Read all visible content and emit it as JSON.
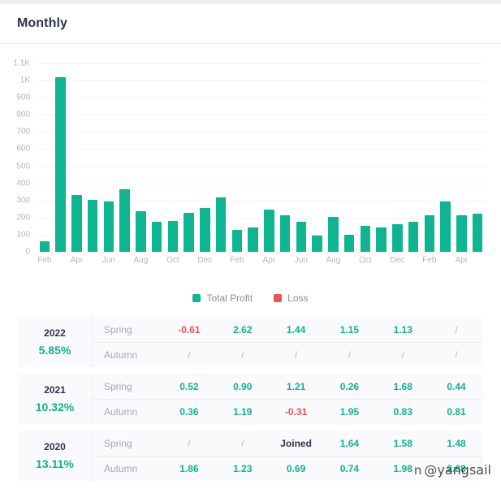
{
  "header": {
    "title": "Monthly"
  },
  "legend": {
    "items": [
      {
        "label": "Total Profit",
        "color": "#0fb491",
        "icon": "square-swatch-icon"
      },
      {
        "label": "Loss",
        "color": "#ea5455",
        "icon": "square-swatch-icon"
      }
    ]
  },
  "watermark": {
    "text": "@yangsail",
    "glyph": "n"
  },
  "chart_data": {
    "type": "bar",
    "title": "Monthly",
    "xlabel": "",
    "ylabel": "",
    "ylim": [
      0,
      1100
    ],
    "grid": true,
    "legend_position": "bottom-center",
    "ytick_labels": [
      "1.1K",
      "1K",
      "900",
      "800",
      "700",
      "600",
      "500",
      "400",
      "300",
      "200",
      "100",
      "0"
    ],
    "ytick_values": [
      1100,
      1000,
      900,
      800,
      700,
      600,
      500,
      400,
      300,
      200,
      100,
      0
    ],
    "xtick_labels": [
      "Feb",
      "Apr",
      "Jun",
      "Aug",
      "Oct",
      "Dec",
      "Feb",
      "Apr",
      "Jun",
      "Aug",
      "Oct",
      "Dec",
      "Feb",
      "Apr"
    ],
    "categories": [
      "Feb",
      "Mar",
      "Apr",
      "May",
      "Jun",
      "Jul",
      "Aug",
      "Sep",
      "Oct",
      "Nov",
      "Dec",
      "Jan",
      "Feb",
      "Mar",
      "Apr",
      "May",
      "Jun",
      "Jul",
      "Aug",
      "Sep",
      "Oct",
      "Nov",
      "Dec",
      "Jan",
      "Feb",
      "Mar",
      "Apr",
      "May"
    ],
    "series": [
      {
        "name": "Total Profit",
        "color": "#0fb491",
        "values": [
          60,
          1020,
          330,
          305,
          295,
          365,
          235,
          175,
          180,
          230,
          255,
          320,
          130,
          140,
          245,
          215,
          175,
          95,
          205,
          100,
          150,
          140,
          160,
          175,
          215,
          295,
          215,
          225
        ]
      }
    ]
  },
  "table": {
    "rows": [
      {
        "year": "2022",
        "percent": "5.85%",
        "seasons": [
          {
            "name": "Spring",
            "values": [
              "-0.61",
              "2.62",
              "1.44",
              "1.15",
              "1.13",
              "/"
            ]
          },
          {
            "name": "Autumn",
            "values": [
              "/",
              "/",
              "/",
              "/",
              "/",
              "/"
            ]
          }
        ]
      },
      {
        "year": "2021",
        "percent": "10.32%",
        "seasons": [
          {
            "name": "Spring",
            "values": [
              "0.52",
              "0.90",
              "1.21",
              "0.26",
              "1.68",
              "0.44"
            ]
          },
          {
            "name": "Autumn",
            "values": [
              "0.36",
              "1.19",
              "-0.31",
              "1.95",
              "0.83",
              "0.81"
            ]
          }
        ]
      },
      {
        "year": "2020",
        "percent": "13.11%",
        "seasons": [
          {
            "name": "Spring",
            "values": [
              "/",
              "/",
              "Joined",
              "1.64",
              "1.58",
              "1.48"
            ]
          },
          {
            "name": "Autumn",
            "values": [
              "1.86",
              "1.23",
              "0.69",
              "0.74",
              "1.98",
              "2.88"
            ]
          }
        ]
      }
    ]
  }
}
